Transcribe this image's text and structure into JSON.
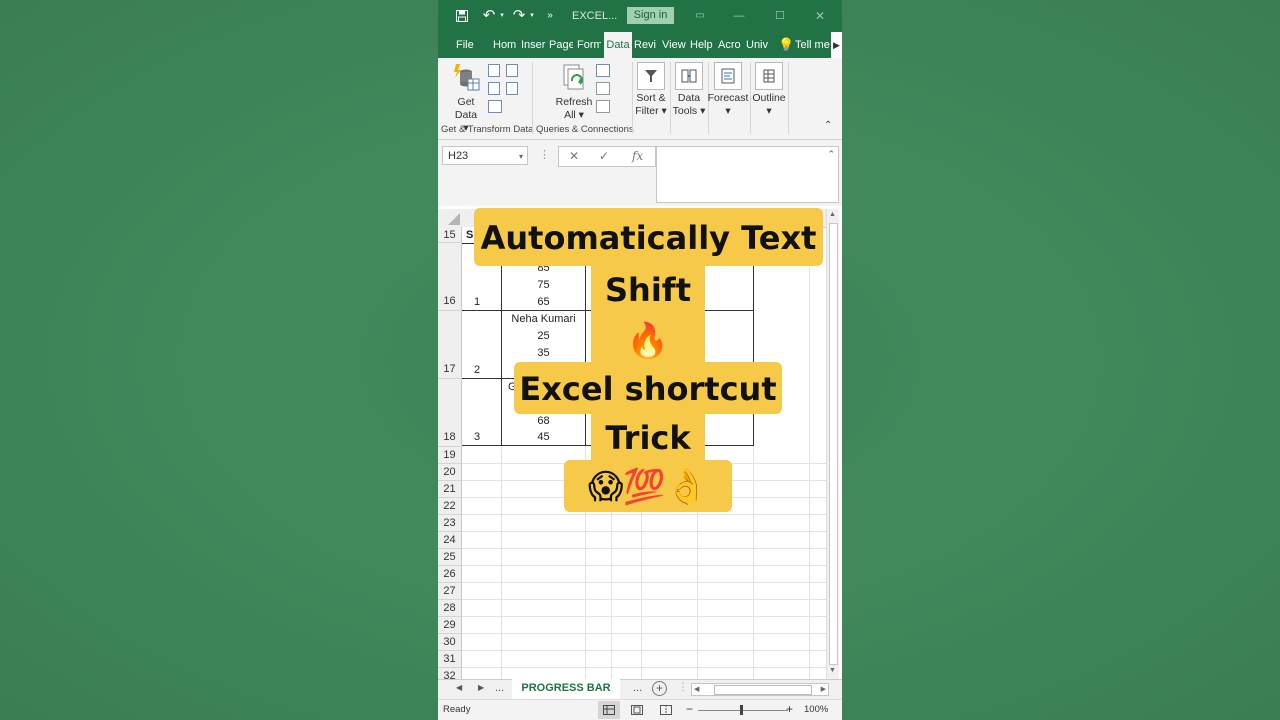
{
  "titlebar": {
    "title": "EXCEL...",
    "signin": "Sign in",
    "more": "»"
  },
  "tabs": [
    "File",
    "Hom",
    "Inser",
    "Page",
    "Form",
    "Data",
    "Revi",
    "View",
    "Help",
    "Acro",
    "Univ",
    "Tell me"
  ],
  "active_tab": "Data",
  "ribbon": {
    "get_data": [
      "Get",
      "Data ▾"
    ],
    "refresh": [
      "Refresh",
      "All ▾"
    ],
    "sort_filter": [
      "Sort &",
      "Filter ▾"
    ],
    "data_tools": [
      "Data",
      "Tools ▾"
    ],
    "forecast": [
      "Forecast",
      "▾"
    ],
    "outline": [
      "Outline",
      "▾"
    ],
    "group_get_transform": "Get & Transform Data",
    "group_queries": "Queries & Connections"
  },
  "formula_bar": {
    "name_box": "H23",
    "cancel": "✕",
    "enter": "✓",
    "fx": "fx"
  },
  "grid": {
    "rows": [
      "15",
      "16",
      "17",
      "18",
      "19",
      "20",
      "21",
      "22",
      "23",
      "24",
      "25",
      "26",
      "27",
      "28",
      "29",
      "30",
      "31",
      "32"
    ],
    "header_s": "S",
    "row16": {
      "sno": "1",
      "lines": [
        "85",
        "75",
        "65"
      ]
    },
    "row17": {
      "sno": "2",
      "lines": [
        "Neha Kumari",
        "25",
        "35"
      ]
    },
    "row18": {
      "sno": "3",
      "lines": [
        "G",
        "68",
        "45"
      ]
    }
  },
  "sheet": {
    "tab": "PROGRESS BAR",
    "dots": "...",
    "dots2": "..."
  },
  "status": {
    "ready": "Ready",
    "zoom": "100%",
    "minus": "−",
    "plus": "+"
  },
  "overlay": {
    "line1": "Automatically Text",
    "line2": "Shift",
    "emoji1": "🔥",
    "line3": "Excel shortcut",
    "line4": "Trick",
    "emoji2": "😱💯👌"
  },
  "colors": {
    "excel_green": "#217346",
    "overlay_yellow": "#f7c948",
    "background_green": "#428a5c"
  }
}
